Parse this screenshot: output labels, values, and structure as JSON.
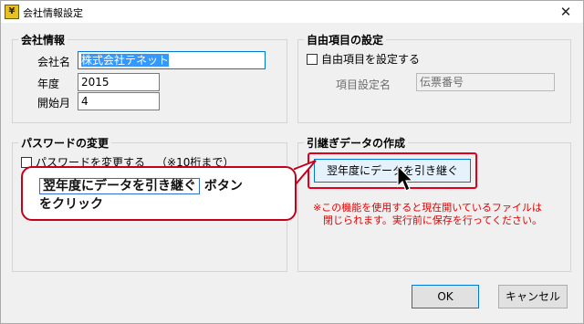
{
  "window": {
    "title": "会社情報設定",
    "close_glyph": "✕"
  },
  "company_group": {
    "title": "会社情報",
    "name_label": "会社名",
    "name_value": "株式会社テネット",
    "year_label": "年度",
    "year_value": "2015",
    "start_month_label": "開始月",
    "start_month_value": "4"
  },
  "custom_group": {
    "title": "自由項目の設定",
    "checkbox_label": "自由項目を設定する",
    "checked": false,
    "item_name_label": "項目設定名",
    "item_name_value": "伝票番号"
  },
  "password_group": {
    "title": "パスワードの変更",
    "checkbox_label": "パスワードを変更する",
    "checked": false,
    "hint": "（※10桁まで）"
  },
  "transfer_group": {
    "title": "引継ぎデータの作成",
    "button_label": "翌年度にデータを引き継ぐ",
    "notice_line1": "※この機能を使用すると現在開いているファイルは",
    "notice_line2": "閉じられます。実行前に保存を行ってください。"
  },
  "callout": {
    "key_text": "翌年度にデータを引き継ぐ",
    "line1_suffix": " ボタン",
    "line2": "をクリック",
    "border_color": "#c4001a"
  },
  "footer": {
    "ok_label": "OK",
    "cancel_label": "キャンセル"
  },
  "colors": {
    "accent": "#0078d7",
    "highlight": "#e0001b",
    "notice": "#e00000"
  }
}
